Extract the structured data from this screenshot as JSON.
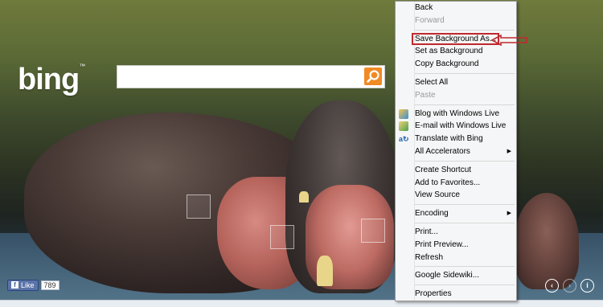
{
  "logo": {
    "text": "bing",
    "tm": "™"
  },
  "search": {
    "value": "",
    "placeholder": ""
  },
  "facebook": {
    "like_label": "Like",
    "count": "789"
  },
  "nav": {
    "prev": "‹",
    "next": "›",
    "info": "i"
  },
  "context_menu": {
    "items": [
      {
        "label": "Back",
        "disabled": false
      },
      {
        "label": "Forward",
        "disabled": true
      },
      {
        "label": "Save Background As...",
        "highlight": true
      },
      {
        "label": "Set as Background"
      },
      {
        "label": "Copy Background"
      },
      {
        "label": "Select All"
      },
      {
        "label": "Paste",
        "disabled": true
      },
      {
        "label": "Blog with Windows Live",
        "icon": "windows-live-writer-icon"
      },
      {
        "label": "E-mail with Windows Live",
        "icon": "windows-live-mail-icon"
      },
      {
        "label": "Translate with Bing",
        "icon": "translate-icon"
      },
      {
        "label": "All Accelerators",
        "submenu": true
      },
      {
        "label": "Create Shortcut"
      },
      {
        "label": "Add to Favorites..."
      },
      {
        "label": "View Source"
      },
      {
        "label": "Encoding",
        "submenu": true
      },
      {
        "label": "Print..."
      },
      {
        "label": "Print Preview..."
      },
      {
        "label": "Refresh"
      },
      {
        "label": "Google Sidewiki..."
      },
      {
        "label": "Properties"
      }
    ]
  },
  "colors": {
    "search_button": "#f08a24",
    "highlight_box": "#c0282f",
    "facebook": "#5b74a8"
  }
}
